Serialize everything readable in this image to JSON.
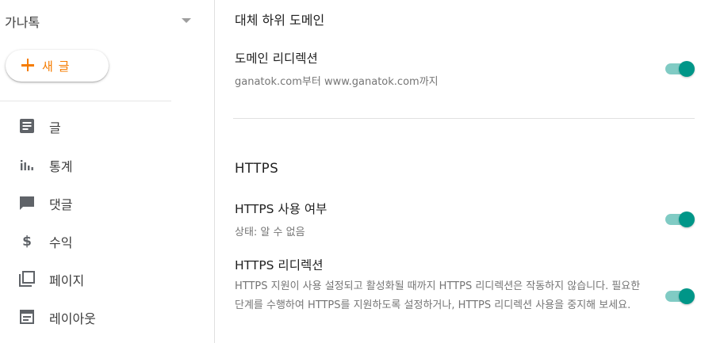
{
  "sidebar": {
    "blog_name": "가나톡",
    "new_post_label": "새 글",
    "items": [
      {
        "label": "글",
        "icon": "posts-icon"
      },
      {
        "label": "통계",
        "icon": "stats-icon"
      },
      {
        "label": "댓글",
        "icon": "comment-icon"
      },
      {
        "label": "수익",
        "icon": "dollar-icon"
      },
      {
        "label": "페이지",
        "icon": "pages-icon"
      },
      {
        "label": "레이아웃",
        "icon": "layout-icon"
      }
    ]
  },
  "main": {
    "alt_subdomain_title": "대체 하위 도메인",
    "domain_redirect": {
      "title": "도메인 리디렉션",
      "desc": "ganatok.com부터 www.ganatok.com까지",
      "enabled": true
    },
    "https_section_title": "HTTPS",
    "https_enabled": {
      "title": "HTTPS 사용 여부",
      "desc": "상태: 알 수 없음",
      "enabled": true
    },
    "https_redirect": {
      "title": "HTTPS 리디렉션",
      "desc": "HTTPS 지원이 사용 설정되고 활성화될 때까지 HTTPS 리디렉션은 작동하지 않습니다. 필요한 단계를 수행하여 HTTPS를 지원하도록 설정하거나, HTTPS 리디렉션 사용을 중지해 보세요.",
      "enabled": true
    }
  },
  "colors": {
    "accent_orange": "#f57c00",
    "toggle_thumb": "#009688",
    "toggle_track": "#80cbc4",
    "icon_gray": "#5f6368"
  }
}
